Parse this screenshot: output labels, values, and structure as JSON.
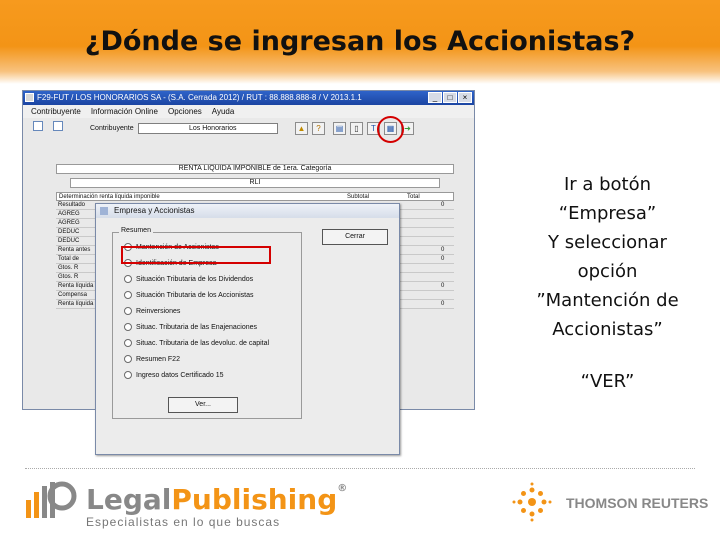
{
  "slide": {
    "title": "¿Dónde se ingresan los Accionistas?"
  },
  "window": {
    "title": "F29-FUT / LOS HONORARIOS SA - (S.A. Cerrada 2012) / RUT : 88.888.888-8 / V 2013.1.1",
    "menu": [
      "Contribuyente",
      "Información Online",
      "Opciones",
      "Ayuda"
    ],
    "contribuyente_label": "Contribuyente",
    "contribuyente_value": "Los Honorarios",
    "toolbar_icons": [
      "folder-icon",
      "help-icon",
      "document-icon",
      "calculator-icon",
      "tools-icon",
      "company-icon",
      "exit-icon"
    ]
  },
  "grid": {
    "title": "RENTA LIQUIDA IMPONIBLE de 1era. Categoría",
    "subheader": "RLI",
    "columns": [
      "Determinación renta líquida imponible",
      "Subtotal",
      "Total"
    ],
    "rows": [
      {
        "label": "Resultado",
        "val": "0"
      },
      {
        "label": "AGREG",
        "val": ""
      },
      {
        "label": "AGREG",
        "val": ""
      },
      {
        "label": "DEDUC",
        "val": ""
      },
      {
        "label": "DEDUC",
        "val": ""
      },
      {
        "label": "Renta antes",
        "val": "0"
      },
      {
        "label": "Total de",
        "val": "0"
      },
      {
        "label": "Gtos. R",
        "val": ""
      },
      {
        "label": "Gtos. R",
        "val": ""
      },
      {
        "label": "Renta líquida",
        "val": "0"
      },
      {
        "label": "Compensa",
        "val": ""
      },
      {
        "label": "Renta líquida",
        "val": "0"
      }
    ]
  },
  "dialog": {
    "title": "Empresa y Accionistas",
    "group_label": "Resumen",
    "options": [
      "Mantención de Accionistas",
      "Identificación de Empresa",
      "Situación Tributaria de los Dividendos",
      "Situación Tributaria de los Accionistas",
      "Reinversiones",
      "Situac. Tributaria de las Enajenaciones",
      "Situac. Tributaria de las devoluc. de capital",
      "Resumen F22",
      "Ingreso datos Certificado 15"
    ],
    "selected_index": 0,
    "close_button": "Cerrar",
    "view_button": "Ver..."
  },
  "instructions": {
    "lines": [
      "Ir a botón",
      "“Empresa”",
      "Y seleccionar",
      "opción",
      "”Mantención de",
      "Accionistas”"
    ],
    "ver": "“VER”"
  },
  "footer": {
    "logo_left_a": "Legal",
    "logo_left_b": "Publishing",
    "logo_left_mark": "®",
    "tagline": "Especialistas en lo que buscas",
    "logo_right": "THOMSON REUTERS"
  },
  "colors": {
    "header_orange": "#f39416",
    "highlight_red": "#d40000",
    "titlebar_blue": "#2f63c9"
  }
}
